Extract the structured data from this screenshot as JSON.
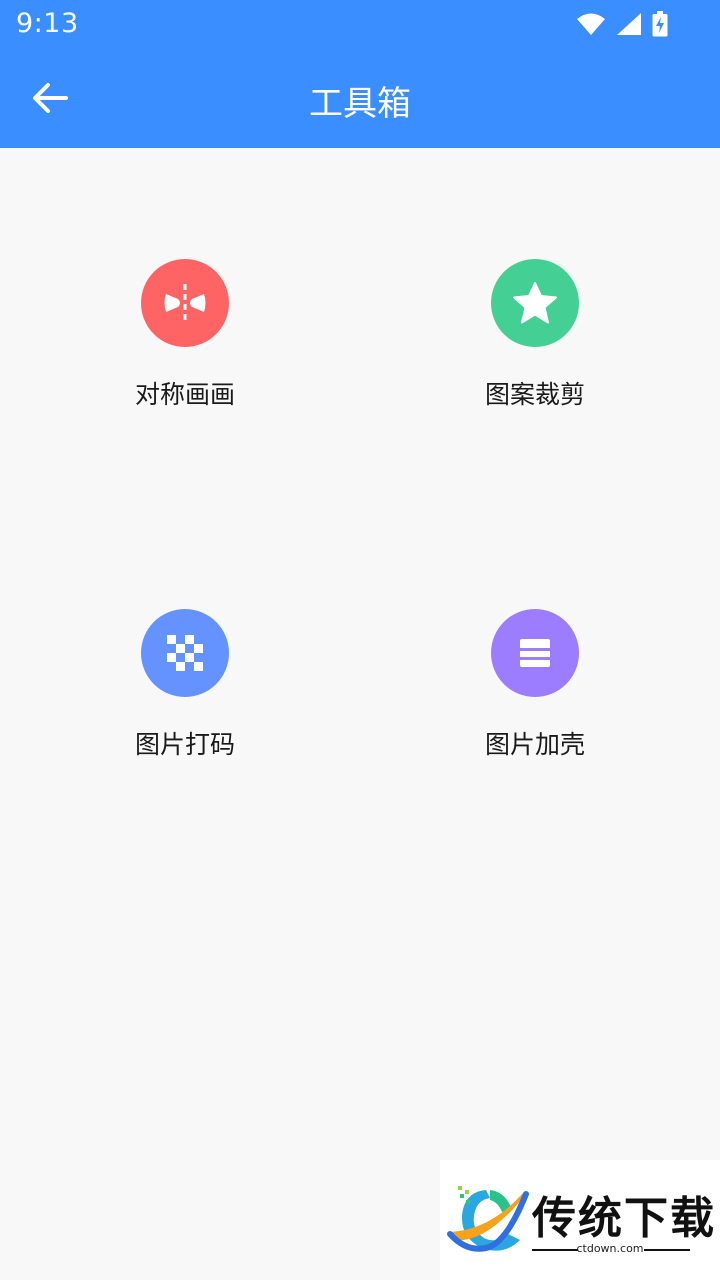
{
  "status_bar": {
    "time": "9:13",
    "icons": [
      "wifi-icon",
      "signal-icon",
      "battery-charging-icon"
    ]
  },
  "header": {
    "title": "工具箱",
    "back_icon": "arrow-left-icon"
  },
  "tools": [
    {
      "label": "对称画画",
      "icon": "symmetry-icon",
      "color": "#ff6464"
    },
    {
      "label": "图案裁剪",
      "icon": "star-icon",
      "color": "#44d094"
    },
    {
      "label": "图片打码",
      "icon": "mosaic-icon",
      "color": "#6492ff"
    },
    {
      "label": "图片加壳",
      "icon": "frame-icon",
      "color": "#9c7cff"
    }
  ],
  "watermark": {
    "brand": "传统下载",
    "url": "ctdown.com"
  },
  "colors": {
    "primary": "#3a8eff",
    "background": "#f8f8f8"
  }
}
